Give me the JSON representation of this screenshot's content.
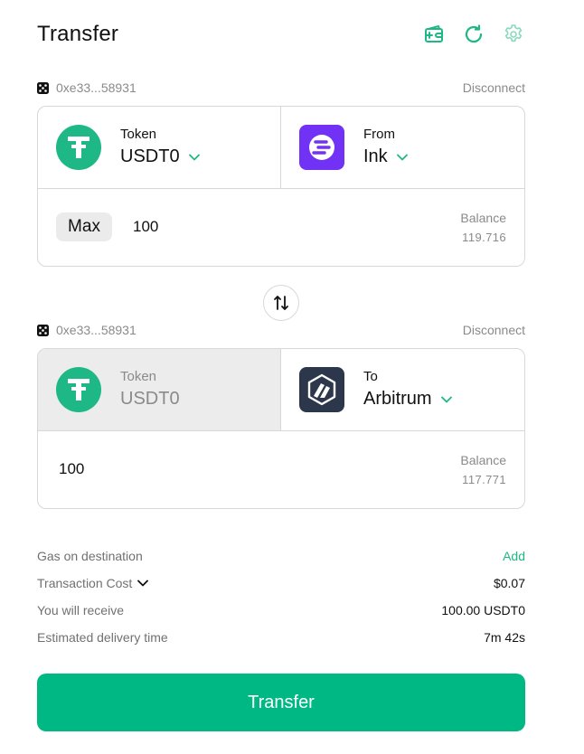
{
  "header": {
    "title": "Transfer",
    "icons": [
      "add-wallet-icon",
      "refresh-icon",
      "settings-icon"
    ],
    "accent": "#1db885"
  },
  "source": {
    "address": "0xe33...58931",
    "disconnect": "Disconnect",
    "token_label": "Token",
    "token_value": "USDT0",
    "chain_label": "From",
    "chain_value": "Ink",
    "max_label": "Max",
    "amount": "100",
    "balance_label": "Balance",
    "balance_value": "119.716"
  },
  "destination": {
    "address": "0xe33...58931",
    "disconnect": "Disconnect",
    "token_label": "Token",
    "token_value": "USDT0",
    "chain_label": "To",
    "chain_value": "Arbitrum",
    "amount": "100",
    "balance_label": "Balance",
    "balance_value": "117.771"
  },
  "details": {
    "gas_label": "Gas on destination",
    "gas_action": "Add",
    "cost_label": "Transaction Cost",
    "cost_value": "$0.07",
    "receive_label": "You will receive",
    "receive_value": "100.00 USDT0",
    "time_label": "Estimated delivery time",
    "time_value": "7m 42s"
  },
  "action": {
    "transfer_label": "Transfer",
    "color": "#00b884"
  },
  "colors": {
    "usdt_green": "#1db885",
    "ink_purple": "#7132f5",
    "arbitrum_dark": "#2d374b"
  }
}
